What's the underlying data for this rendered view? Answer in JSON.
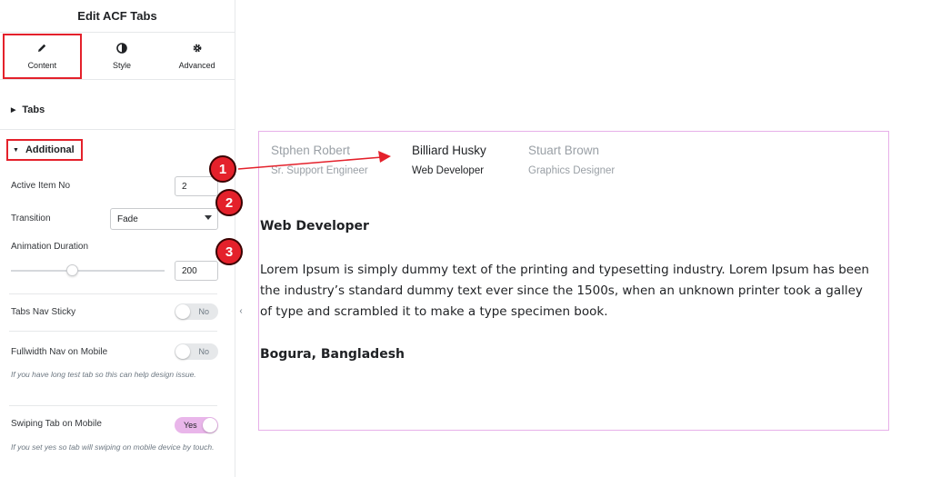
{
  "panel": {
    "title": "Edit ACF Tabs",
    "tabs": [
      {
        "label": "Content",
        "icon": "pencil-icon",
        "active": true
      },
      {
        "label": "Style",
        "icon": "half-circle-icon",
        "active": false
      },
      {
        "label": "Advanced",
        "icon": "gear-icon",
        "active": false
      }
    ],
    "sections": {
      "tabs_label": "Tabs",
      "additional_label": "Additional"
    },
    "controls": {
      "active_item": {
        "label": "Active Item No",
        "value": "2"
      },
      "transition": {
        "label": "Transition",
        "value": "Fade"
      },
      "animation_duration": {
        "label": "Animation Duration",
        "value": "200",
        "slider_level": 0.4
      },
      "tabs_nav_sticky": {
        "label": "Tabs Nav Sticky",
        "state": "No"
      },
      "fullwidth_nav": {
        "label": "Fullwidth Nav on Mobile",
        "state": "No",
        "help": "If you have long test tab so this can help design issue."
      },
      "swiping_tab": {
        "label": "Swiping Tab on Mobile",
        "state": "Yes",
        "help": "If you set yes so tab will swiping on mobile device by touch."
      }
    },
    "collapse_glyph": "‹"
  },
  "preview": {
    "tabs": [
      {
        "name": "Stphen Robert",
        "role": "Sr. Support Engineer",
        "active": false
      },
      {
        "name": "Billiard Husky",
        "role": "Web Developer",
        "active": true
      },
      {
        "name": "Stuart Brown",
        "role": "Graphics Designer",
        "active": false
      }
    ],
    "content": {
      "title": "Web Developer",
      "body": "Lorem Ipsum is simply dummy text of the printing and typesetting industry. Lorem Ipsum has been the industry’s standard dummy text ever since the 1500s, when an unknown printer took a galley of type and scrambled it to make a type specimen book.",
      "location": "Bogura, Bangladesh"
    }
  },
  "callouts": [
    "1",
    "2",
    "3"
  ],
  "colors": {
    "accent_red": "#e4212b",
    "preview_border": "#e7b0e9",
    "toggle_on": "#e9b6ea"
  }
}
